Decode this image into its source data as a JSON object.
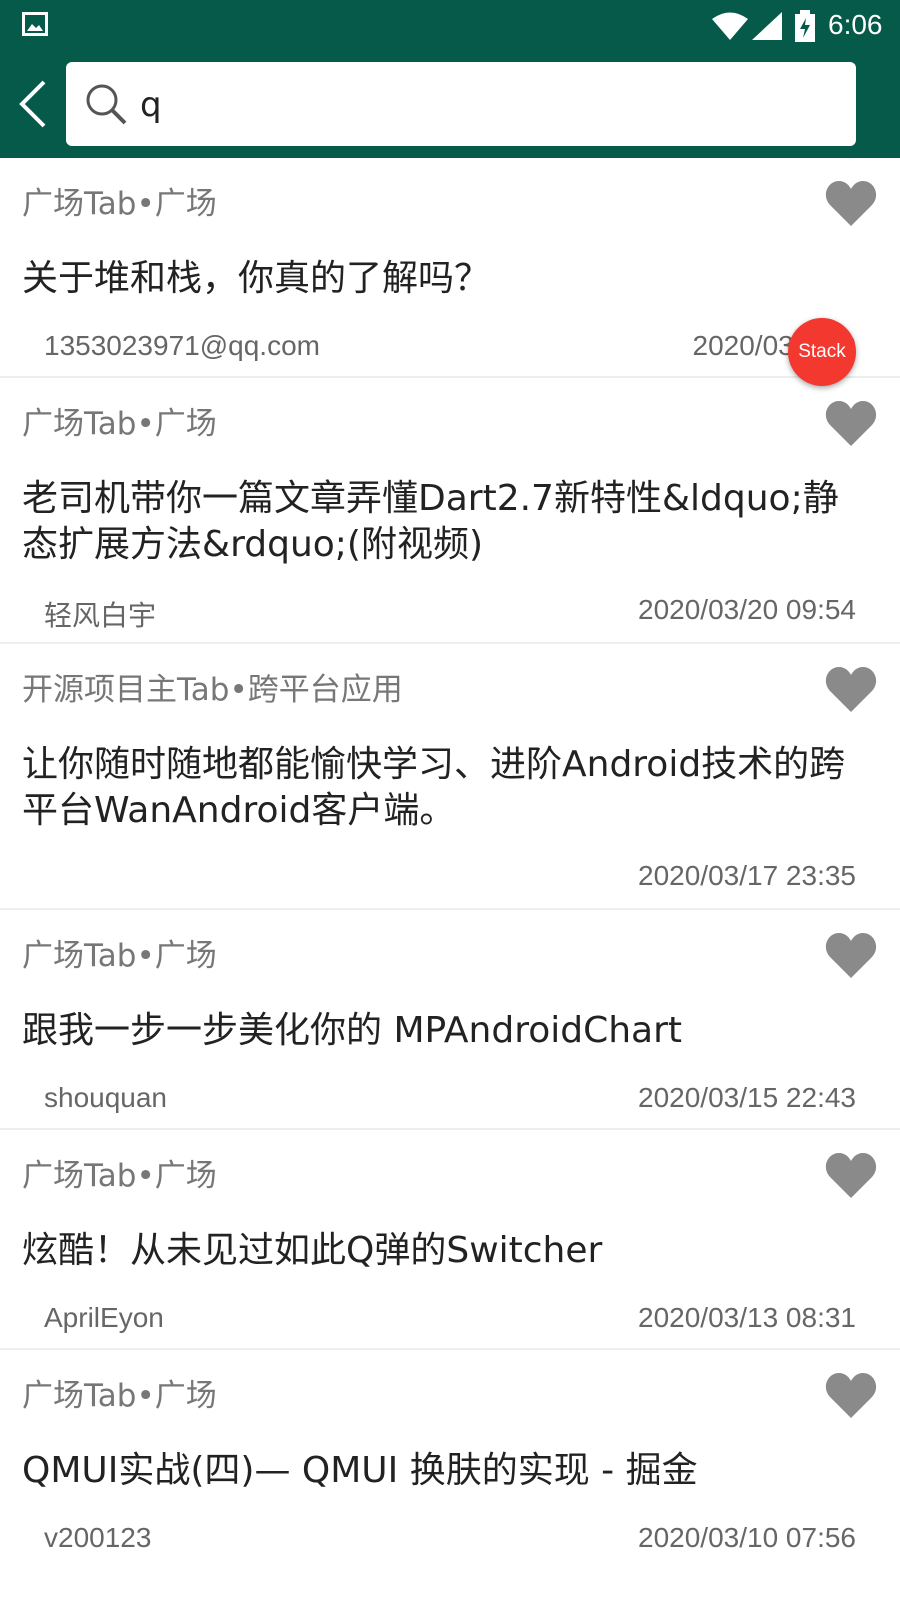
{
  "status_bar": {
    "time": "6:06",
    "icons": [
      "image-icon",
      "wifi-icon",
      "signal-icon",
      "battery-charging-icon"
    ]
  },
  "app_bar": {
    "back_icon": "chevron-left-icon",
    "search": {
      "value": "q",
      "icon": "search-icon"
    },
    "color": "#055a4a"
  },
  "articles": [
    {
      "category": "广场Tab•广场",
      "title": "关于堆和栈，你真的了解吗？",
      "author": "1353023971@qq.com",
      "date": "2020/03/24 0"
    },
    {
      "category": "广场Tab•广场",
      "title": "老司机带你一篇文章弄懂Dart2.7新特性&ldquo;静态扩展方法&rdquo;(附视频)",
      "author": "轻风白宇",
      "date": "2020/03/20 09:54"
    },
    {
      "category": "开源项目主Tab•跨平台应用",
      "title": "让你随时随地都能愉快学习、进阶Android技术的跨平台WanAndroid客户端。",
      "author": "",
      "date": "2020/03/17 23:35"
    },
    {
      "category": "广场Tab•广场",
      "title": "跟我一步一步美化你的 MPAndroidChart",
      "author": "shouquan",
      "date": "2020/03/15 22:43"
    },
    {
      "category": "广场Tab•广场",
      "title": "炫酷！从未见过如此Q弹的Switcher",
      "author": "AprilEyon",
      "date": "2020/03/13 08:31"
    },
    {
      "category": "广场Tab•广场",
      "title": "QMUI实战(四)— QMUI 换肤的实现 - 掘金",
      "author": "v200123",
      "date": "2020/03/10 07:56"
    }
  ],
  "favorite_icon": "heart-icon",
  "fab": {
    "label": "Stack",
    "color": "#f2382f"
  }
}
